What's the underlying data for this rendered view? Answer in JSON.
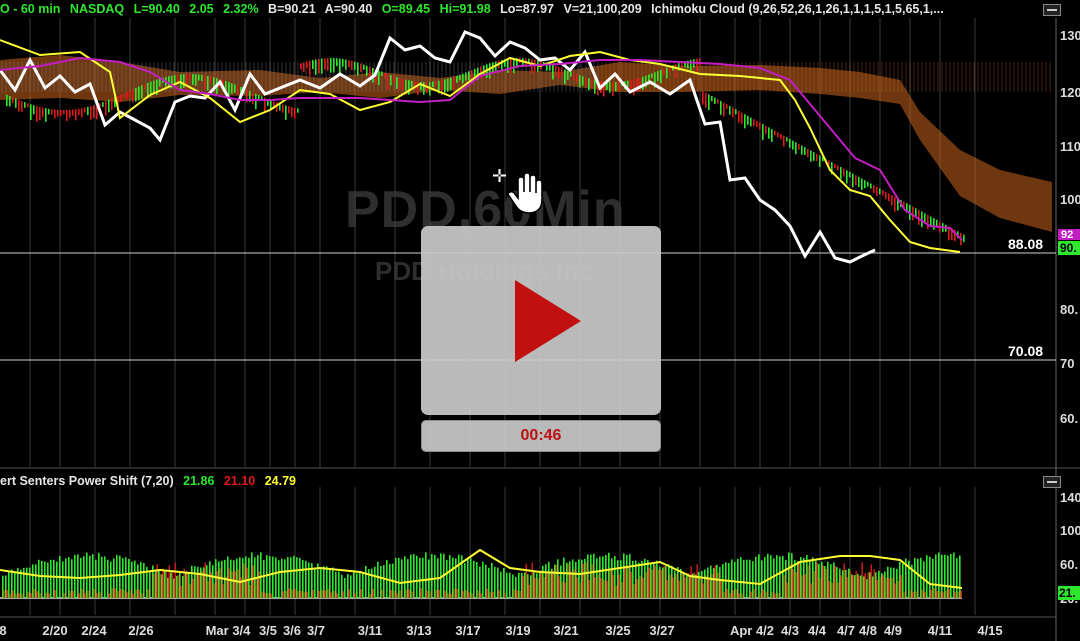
{
  "header": {
    "period": "O - 60 min",
    "exchange": "NASDAQ",
    "last": "L=90.40",
    "change": "2.05",
    "change_pct": "2.32%",
    "bid": "B=90.21",
    "ask": "A=90.40",
    "open": "O=89.45",
    "high": "Hi=91.98",
    "low": "Lo=87.97",
    "volume": "V=21,100,209",
    "study": "Ichimoku Cloud (9,26,52,26,1,26,1,1,1,5,1,5,65,1,..."
  },
  "watermark": {
    "symbol": "PDD,60Min",
    "company": "PDD Holdings Inc"
  },
  "indicator": {
    "name": "ert Senters Power Shift (7,20)",
    "v1": "21.86",
    "v2": "21.10",
    "v3": "24.79"
  },
  "video": {
    "timer": "00:46"
  },
  "price_axis": {
    "ticks": [
      "130",
      "120",
      "110",
      "100",
      "80.",
      "70",
      "60."
    ],
    "badges": [
      "92",
      "90."
    ],
    "hlines": [
      "88.08",
      "70.08"
    ]
  },
  "ind_axis": {
    "ticks": [
      "140",
      "100",
      "60.",
      "20."
    ],
    "badge": "21."
  },
  "x_axis": {
    "labels": [
      "8",
      "2/20",
      "2/24",
      "2/26",
      "Mar 3/4",
      "3/5",
      "3/6",
      "3/7",
      "3/11",
      "3/13",
      "3/17",
      "3/19",
      "3/21",
      "3/25",
      "3/27",
      "Apr 4/2",
      "4/3",
      "4/4",
      "4/7",
      "4/8",
      "4/9",
      "4/11",
      "4/15"
    ]
  },
  "colors": {
    "green": "#2ee82e",
    "red": "#e01a1a",
    "yellow": "#ffff33",
    "magenta": "#c21ec2",
    "cloud_orange": "#c8641e",
    "cloud_gray": "#8a8a9a",
    "grid": "#3a3a3a"
  },
  "chart_data": {
    "type": "line",
    "xlabel": "",
    "ylabel": "",
    "ylim": [
      50,
      135
    ],
    "series": []
  }
}
